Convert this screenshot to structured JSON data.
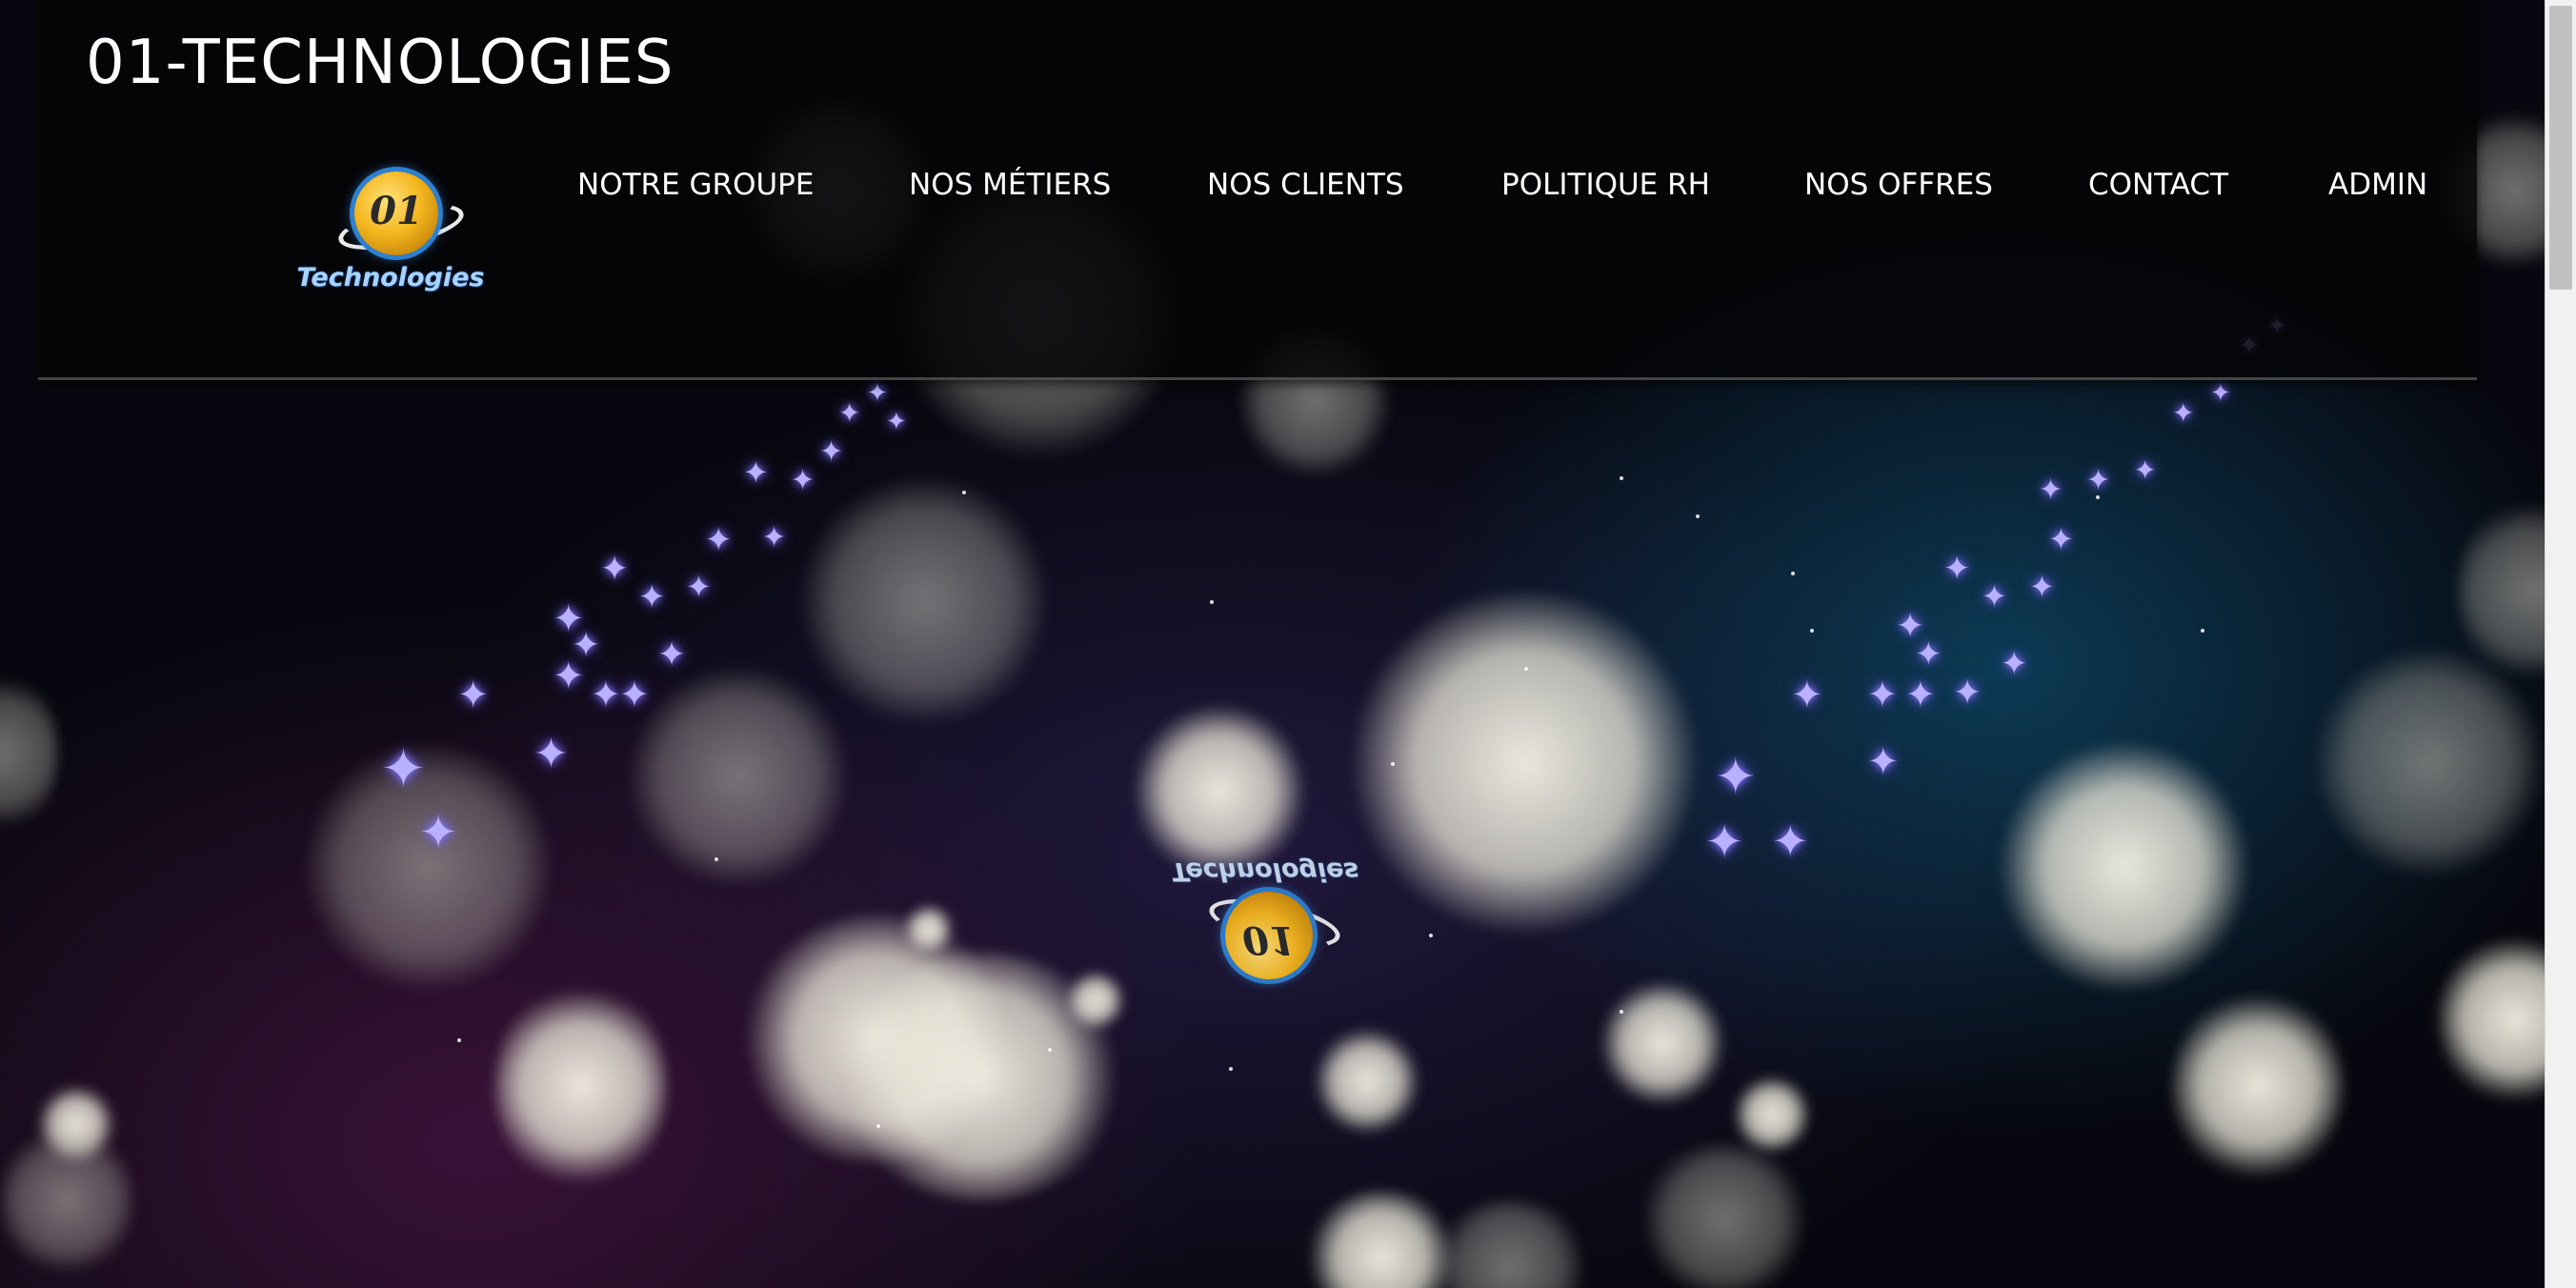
{
  "site": {
    "title": "01-TECHNOLOGIES"
  },
  "logo": {
    "mark": "01",
    "caption": "Technologies"
  },
  "nav": {
    "items": [
      {
        "label": "NOTRE GROUPE"
      },
      {
        "label": "NOS MÉTIERS"
      },
      {
        "label": "NOS CLIENTS"
      },
      {
        "label": "POLITIQUE RH"
      },
      {
        "label": "NOS OFFRES"
      },
      {
        "label": "CONTACT"
      },
      {
        "label": "ADMIN"
      }
    ]
  },
  "hero": {
    "background": "space-bokeh-starfield",
    "reflected_logo_mark": "01",
    "reflected_logo_caption": "Technologies"
  },
  "colors": {
    "header_bg": "#050507",
    "nav_text": "#ffffff",
    "logo_gold": "#f4b61f",
    "logo_blue": "#2d7fd0"
  }
}
